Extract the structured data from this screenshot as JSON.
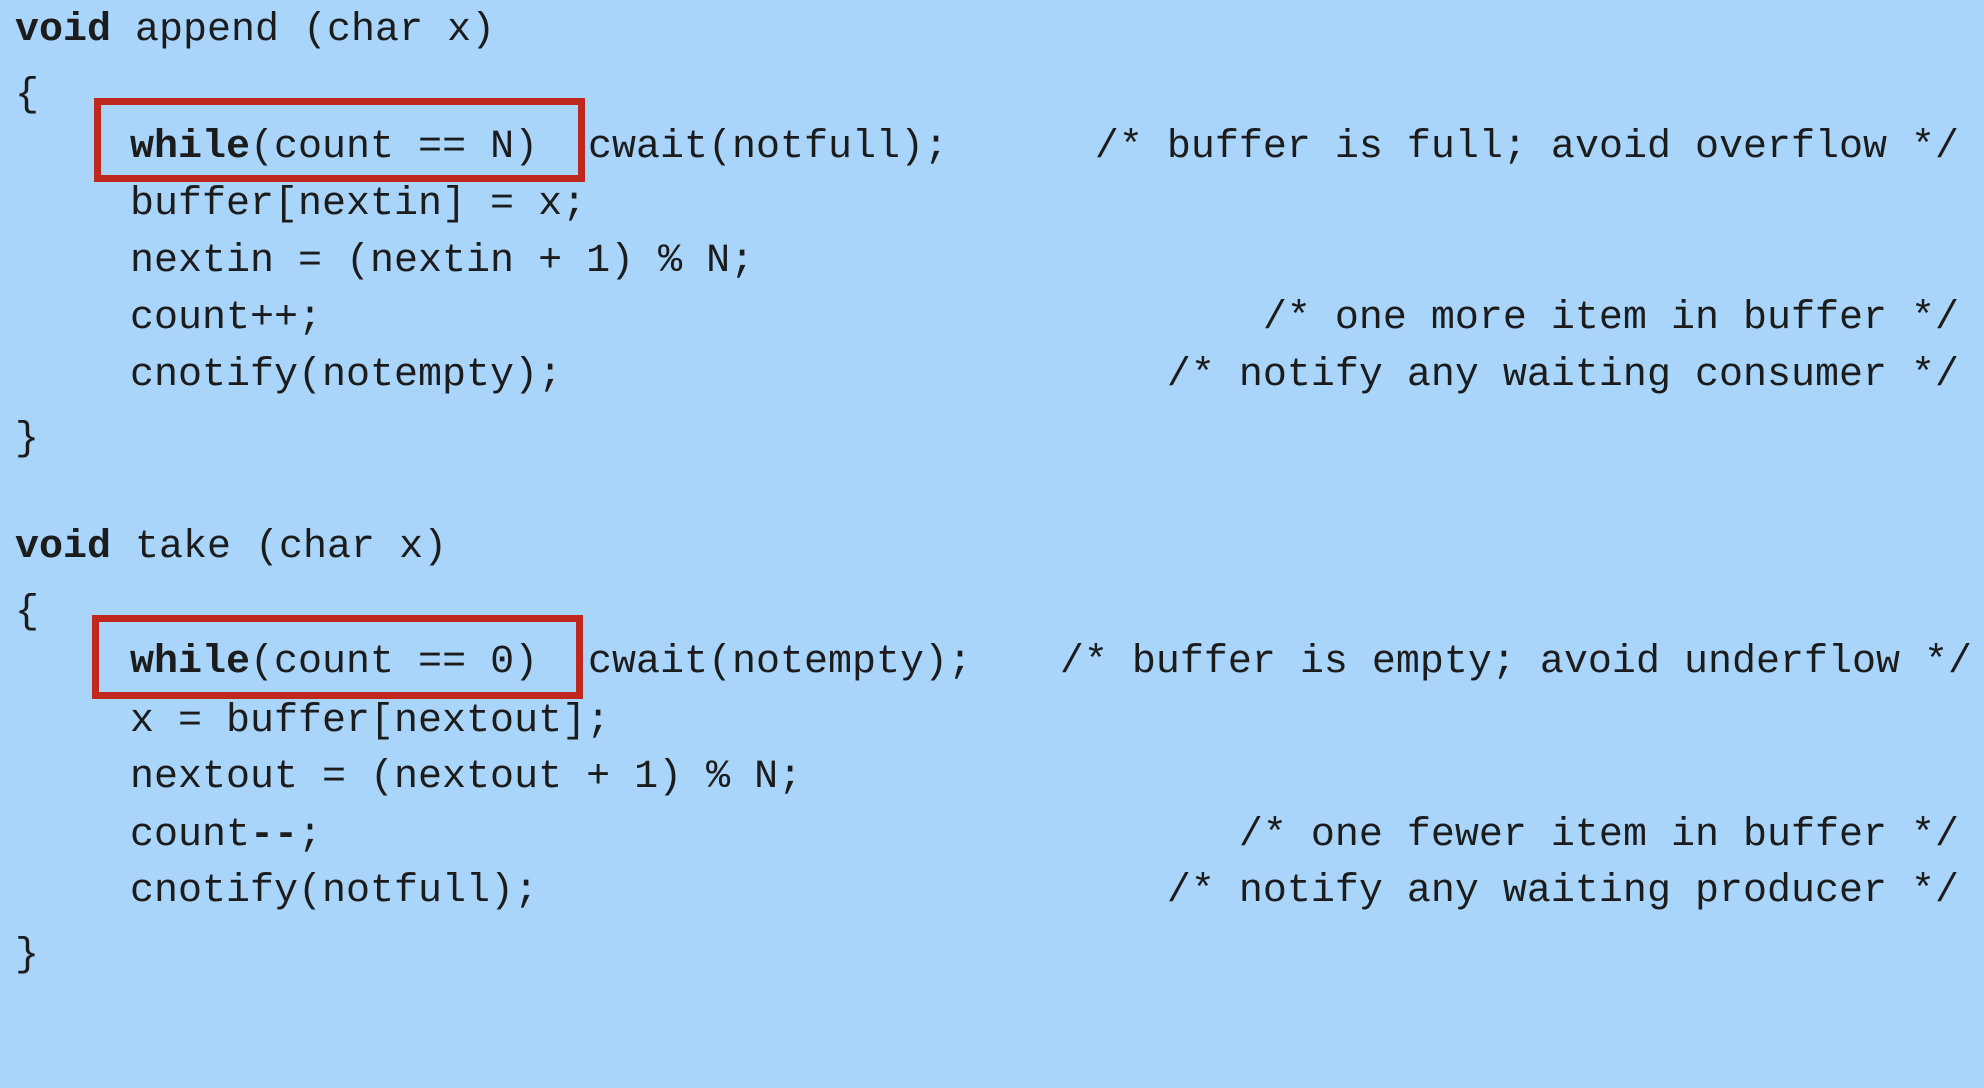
{
  "append": {
    "signature_kw": "void",
    "signature_rest": " append (char x)",
    "open_brace": "{",
    "while_kw": "while",
    "while_cond": "(count == N)",
    "while_action": "cwait(notfull);",
    "while_comment": "/* buffer is full; avoid overflow */",
    "line_buffer": "buffer[nextin] = x;",
    "line_nextin": "nextin = (nextin + 1) % N;",
    "line_count": "count++;",
    "comment_count": "/* one more item in buffer */",
    "line_notify": "cnotify(notempty);",
    "comment_notify": "/* notify any waiting consumer */",
    "close_brace": "}"
  },
  "take": {
    "signature_kw": "void",
    "signature_rest": " take (char x)",
    "open_brace": "{",
    "while_kw": "while",
    "while_cond": "(count == 0)",
    "while_action": "cwait(notempty);",
    "while_comment": "/* buffer is empty; avoid underflow */",
    "line_buffer": "x = buffer[nextout];",
    "line_nextout": "nextout = (nextout + 1) % N;",
    "line_count_name": "count",
    "line_count_op": "--",
    "line_count_end": ";",
    "comment_count": "/* one fewer item in buffer */",
    "line_notify": "cnotify(notfull);",
    "comment_notify": "/* notify any waiting producer */",
    "close_brace": "}"
  },
  "colors": {
    "background": "#a9d5fb",
    "highlight_border": "#c0271d",
    "text": "#1c1c1c"
  }
}
